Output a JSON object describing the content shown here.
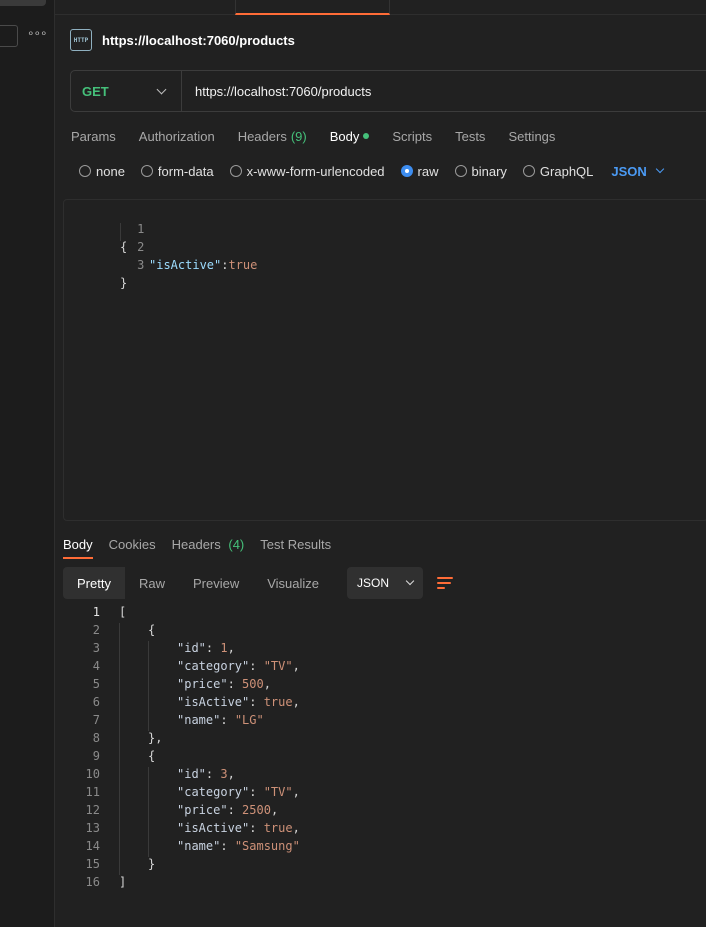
{
  "request": {
    "title": "https://localhost:7060/products",
    "icon_label": "HTTP",
    "method": "GET",
    "url": "https://localhost:7060/products"
  },
  "request_tabs": [
    {
      "label": "Params"
    },
    {
      "label": "Authorization"
    },
    {
      "label": "Headers",
      "count": "(9)"
    },
    {
      "label": "Body",
      "active": true
    },
    {
      "label": "Scripts"
    },
    {
      "label": "Tests"
    },
    {
      "label": "Settings"
    }
  ],
  "body_types": {
    "options": [
      "none",
      "form-data",
      "x-www-form-urlencoded",
      "raw",
      "binary",
      "GraphQL"
    ],
    "selected": "raw",
    "language": "JSON"
  },
  "request_body": {
    "lines": [
      {
        "n": "1",
        "text": "{"
      },
      {
        "n": "2",
        "key": "\"isActive\"",
        "sep": ":",
        "value": "true"
      },
      {
        "n": "3",
        "text": "}"
      }
    ]
  },
  "response_tabs": [
    {
      "label": "Body",
      "active": true
    },
    {
      "label": "Cookies"
    },
    {
      "label": "Headers",
      "count": "(4)"
    },
    {
      "label": "Test Results"
    }
  ],
  "response_views": [
    "Pretty",
    "Raw",
    "Preview",
    "Visualize"
  ],
  "response_format": "JSON",
  "response_body": {
    "lines": [
      {
        "n": "1",
        "text": "["
      },
      {
        "n": "2",
        "text": "{"
      },
      {
        "n": "3",
        "key": "\"id\"",
        "value": "1",
        "comma": ","
      },
      {
        "n": "4",
        "key": "\"category\"",
        "value": "\"TV\"",
        "comma": ","
      },
      {
        "n": "5",
        "key": "\"price\"",
        "value": "500",
        "comma": ","
      },
      {
        "n": "6",
        "key": "\"isActive\"",
        "value": "true",
        "comma": ","
      },
      {
        "n": "7",
        "key": "\"name\"",
        "value": "\"LG\"",
        "comma": ""
      },
      {
        "n": "8",
        "text": "},"
      },
      {
        "n": "9",
        "text": "{"
      },
      {
        "n": "10",
        "key": "\"id\"",
        "value": "3",
        "comma": ","
      },
      {
        "n": "11",
        "key": "\"category\"",
        "value": "\"TV\"",
        "comma": ","
      },
      {
        "n": "12",
        "key": "\"price\"",
        "value": "2500",
        "comma": ","
      },
      {
        "n": "13",
        "key": "\"isActive\"",
        "value": "true",
        "comma": ","
      },
      {
        "n": "14",
        "key": "\"name\"",
        "value": "\"Samsung\"",
        "comma": ""
      },
      {
        "n": "15",
        "text": "}"
      },
      {
        "n": "16",
        "text": "]"
      }
    ]
  },
  "colors": {
    "accent": "#ff6c37",
    "get_method": "#45c07a",
    "link_blue": "#4b9bf5"
  }
}
